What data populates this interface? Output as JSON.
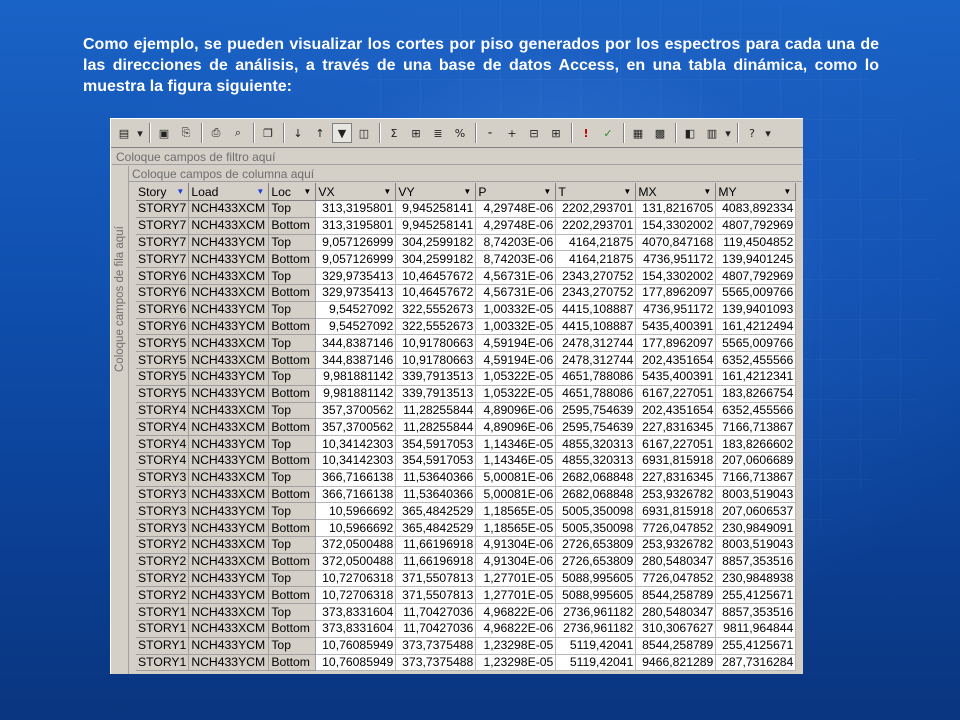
{
  "slide": {
    "text": "Como ejemplo, se pueden visualizar los cortes por piso generados por los espectros para cada una de las direcciones de análisis, a través de una base de datos Access, en una tabla dinámica, como lo muestra la figura siguiente:"
  },
  "pivot": {
    "filter_zone": "Coloque campos de filtro aquí",
    "column_zone": "Coloque campos de columna aquí",
    "row_zone": "Coloque campos de fila aquí",
    "headers": [
      "Story",
      "Load",
      "Loc",
      "VX",
      "VY",
      "P",
      "T",
      "MX",
      "MY"
    ],
    "rows": [
      [
        "STORY7",
        "NCH433XCM",
        "Top",
        "313,3195801",
        "9,945258141",
        "4,29748E-06",
        "2202,293701",
        "131,8216705",
        "4083,892334"
      ],
      [
        "STORY7",
        "NCH433XCM",
        "Bottom",
        "313,3195801",
        "9,945258141",
        "4,29748E-06",
        "2202,293701",
        "154,3302002",
        "4807,792969"
      ],
      [
        "STORY7",
        "NCH433YCM",
        "Top",
        "9,057126999",
        "304,2599182",
        "8,74203E-06",
        "4164,21875",
        "4070,847168",
        "119,4504852"
      ],
      [
        "STORY7",
        "NCH433YCM",
        "Bottom",
        "9,057126999",
        "304,2599182",
        "8,74203E-06",
        "4164,21875",
        "4736,951172",
        "139,9401245"
      ],
      [
        "STORY6",
        "NCH433XCM",
        "Top",
        "329,9735413",
        "10,46457672",
        "4,56731E-06",
        "2343,270752",
        "154,3302002",
        "4807,792969"
      ],
      [
        "STORY6",
        "NCH433XCM",
        "Bottom",
        "329,9735413",
        "10,46457672",
        "4,56731E-06",
        "2343,270752",
        "177,8962097",
        "5565,009766"
      ],
      [
        "STORY6",
        "NCH433YCM",
        "Top",
        "9,54527092",
        "322,5552673",
        "1,00332E-05",
        "4415,108887",
        "4736,951172",
        "139,9401093"
      ],
      [
        "STORY6",
        "NCH433YCM",
        "Bottom",
        "9,54527092",
        "322,5552673",
        "1,00332E-05",
        "4415,108887",
        "5435,400391",
        "161,4212494"
      ],
      [
        "STORY5",
        "NCH433XCM",
        "Top",
        "344,8387146",
        "10,91780663",
        "4,59194E-06",
        "2478,312744",
        "177,8962097",
        "5565,009766"
      ],
      [
        "STORY5",
        "NCH433XCM",
        "Bottom",
        "344,8387146",
        "10,91780663",
        "4,59194E-06",
        "2478,312744",
        "202,4351654",
        "6352,455566"
      ],
      [
        "STORY5",
        "NCH433YCM",
        "Top",
        "9,981881142",
        "339,7913513",
        "1,05322E-05",
        "4651,788086",
        "5435,400391",
        "161,4212341"
      ],
      [
        "STORY5",
        "NCH433YCM",
        "Bottom",
        "9,981881142",
        "339,7913513",
        "1,05322E-05",
        "4651,788086",
        "6167,227051",
        "183,8266754"
      ],
      [
        "STORY4",
        "NCH433XCM",
        "Top",
        "357,3700562",
        "11,28255844",
        "4,89096E-06",
        "2595,754639",
        "202,4351654",
        "6352,455566"
      ],
      [
        "STORY4",
        "NCH433XCM",
        "Bottom",
        "357,3700562",
        "11,28255844",
        "4,89096E-06",
        "2595,754639",
        "227,8316345",
        "7166,713867"
      ],
      [
        "STORY4",
        "NCH433YCM",
        "Top",
        "10,34142303",
        "354,5917053",
        "1,14346E-05",
        "4855,320313",
        "6167,227051",
        "183,8266602"
      ],
      [
        "STORY4",
        "NCH433YCM",
        "Bottom",
        "10,34142303",
        "354,5917053",
        "1,14346E-05",
        "4855,320313",
        "6931,815918",
        "207,0606689"
      ],
      [
        "STORY3",
        "NCH433XCM",
        "Top",
        "366,7166138",
        "11,53640366",
        "5,00081E-06",
        "2682,068848",
        "227,8316345",
        "7166,713867"
      ],
      [
        "STORY3",
        "NCH433XCM",
        "Bottom",
        "366,7166138",
        "11,53640366",
        "5,00081E-06",
        "2682,068848",
        "253,9326782",
        "8003,519043"
      ],
      [
        "STORY3",
        "NCH433YCM",
        "Top",
        "10,5966692",
        "365,4842529",
        "1,18565E-05",
        "5005,350098",
        "6931,815918",
        "207,0606537"
      ],
      [
        "STORY3",
        "NCH433YCM",
        "Bottom",
        "10,5966692",
        "365,4842529",
        "1,18565E-05",
        "5005,350098",
        "7726,047852",
        "230,9849091"
      ],
      [
        "STORY2",
        "NCH433XCM",
        "Top",
        "372,0500488",
        "11,66196918",
        "4,91304E-06",
        "2726,653809",
        "253,9326782",
        "8003,519043"
      ],
      [
        "STORY2",
        "NCH433XCM",
        "Bottom",
        "372,0500488",
        "11,66196918",
        "4,91304E-06",
        "2726,653809",
        "280,5480347",
        "8857,353516"
      ],
      [
        "STORY2",
        "NCH433YCM",
        "Top",
        "10,72706318",
        "371,5507813",
        "1,27701E-05",
        "5088,995605",
        "7726,047852",
        "230,9848938"
      ],
      [
        "STORY2",
        "NCH433YCM",
        "Bottom",
        "10,72706318",
        "371,5507813",
        "1,27701E-05",
        "5088,995605",
        "8544,258789",
        "255,4125671"
      ],
      [
        "STORY1",
        "NCH433XCM",
        "Top",
        "373,8331604",
        "11,70427036",
        "4,96822E-06",
        "2736,961182",
        "280,5480347",
        "8857,353516"
      ],
      [
        "STORY1",
        "NCH433XCM",
        "Bottom",
        "373,8331604",
        "11,70427036",
        "4,96822E-06",
        "2736,961182",
        "310,3067627",
        "9811,964844"
      ],
      [
        "STORY1",
        "NCH433YCM",
        "Top",
        "10,76085949",
        "373,7375488",
        "1,23298E-05",
        "5119,42041",
        "8544,258789",
        "255,4125671"
      ],
      [
        "STORY1",
        "NCH433YCM",
        "Bottom",
        "10,76085949",
        "373,7375488",
        "1,23298E-05",
        "5119,42041",
        "9466,821289",
        "287,7316284"
      ]
    ]
  },
  "toolbar": {
    "icons": [
      "field-list-icon",
      "dropdown-icon",
      "save-icon",
      "export-icon",
      "print-icon",
      "print-preview-icon",
      "copy-icon",
      "sort-asc-icon",
      "sort-desc-icon",
      "autofilter-icon",
      "show-top-icon",
      "autocalc-icon",
      "subtotal-icon",
      "calculated-field-icon",
      "percent-icon",
      "collapse-icon",
      "expand-icon",
      "hide-details-icon",
      "show-details-icon",
      "refresh-icon",
      "alert-icon",
      "chart-icon",
      "properties-icon",
      "commands-icon",
      "layout-icon",
      "view-icon",
      "help-icon",
      "more-icon"
    ]
  }
}
